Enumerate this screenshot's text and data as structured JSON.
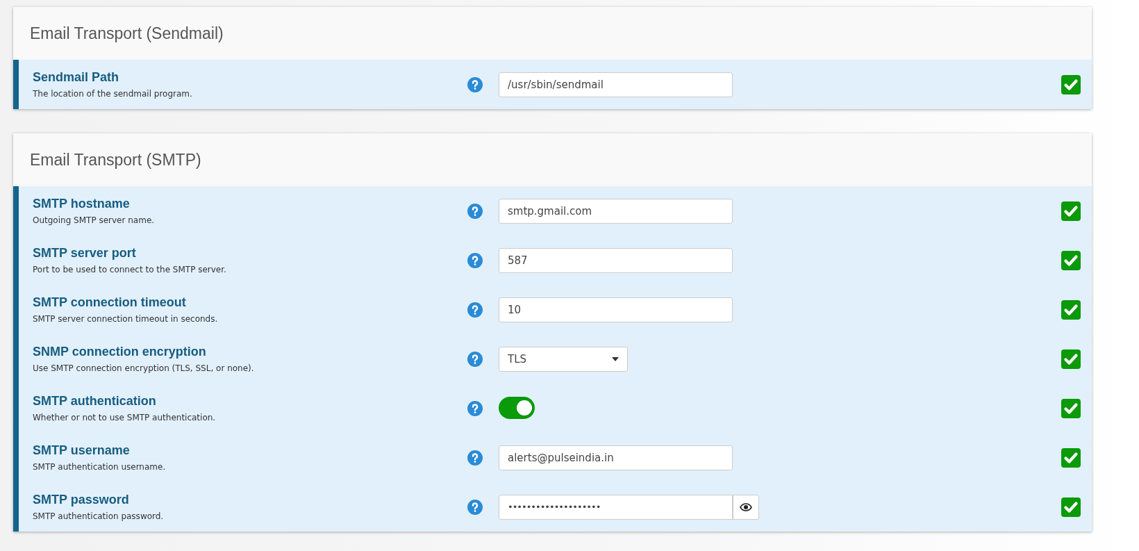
{
  "panels": [
    {
      "title": "Email Transport (Sendmail)",
      "settings": [
        {
          "kind": "text",
          "label": "Sendmail Path",
          "description": "The location of the sendmail program.",
          "value": "/usr/sbin/sendmail",
          "checked": true
        }
      ]
    },
    {
      "title": "Email Transport (SMTP)",
      "settings": [
        {
          "kind": "text",
          "label": "SMTP hostname",
          "description": "Outgoing SMTP server name.",
          "value": "smtp.gmail.com",
          "checked": true
        },
        {
          "kind": "text",
          "label": "SMTP server port",
          "description": "Port to be used to connect to the SMTP server.",
          "value": "587",
          "checked": true
        },
        {
          "kind": "text",
          "label": "SMTP connection timeout",
          "description": "SMTP server connection timeout in seconds.",
          "value": "10",
          "checked": true
        },
        {
          "kind": "select",
          "label": "SNMP connection encryption",
          "description": "Use SMTP connection encryption (TLS, SSL, or none).",
          "value": "TLS",
          "checked": true
        },
        {
          "kind": "toggle",
          "label": "SMTP authentication",
          "description": "Whether or not to use SMTP authentication.",
          "on": true,
          "checked": true
        },
        {
          "kind": "text",
          "label": "SMTP username",
          "description": "SMTP authentication username.",
          "value": "alerts@pulseindia.in",
          "checked": true
        },
        {
          "kind": "password",
          "label": "SMTP password",
          "description": "SMTP authentication password.",
          "value": "••••••••••••••••••••",
          "checked": true
        }
      ]
    }
  ]
}
